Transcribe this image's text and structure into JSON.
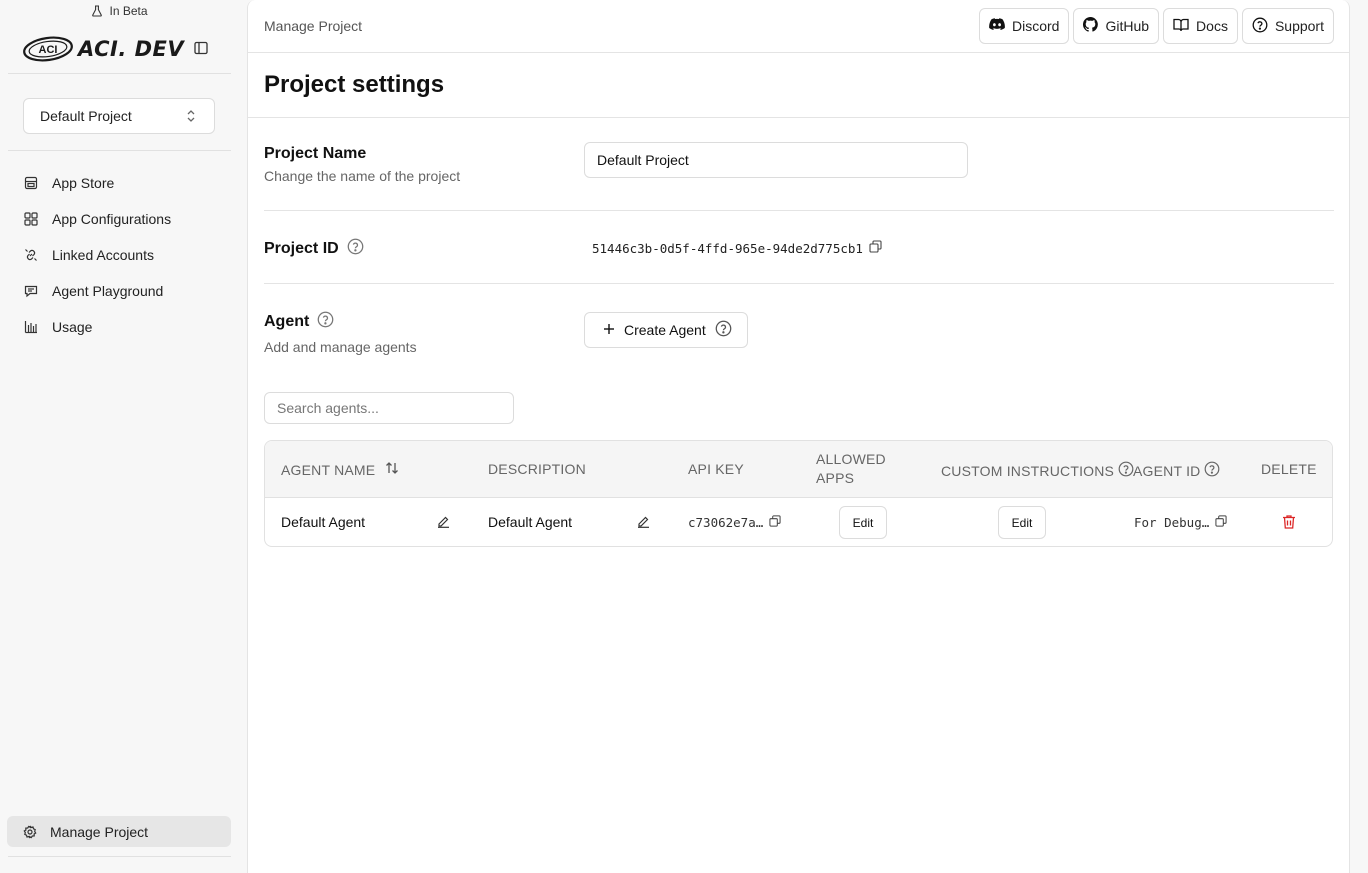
{
  "sidebar": {
    "beta_label": "In Beta",
    "logo_badge": "ACI",
    "logo_text": "ACI. DEV",
    "project_select": "Default Project",
    "nav": [
      {
        "label": "App Store",
        "icon": "store-icon"
      },
      {
        "label": "App Configurations",
        "icon": "grid-icon"
      },
      {
        "label": "Linked Accounts",
        "icon": "link-icon"
      },
      {
        "label": "Agent Playground",
        "icon": "chat-icon"
      },
      {
        "label": "Usage",
        "icon": "bar-chart-icon"
      }
    ],
    "manage_project": "Manage Project"
  },
  "header": {
    "breadcrumb": "Manage Project",
    "buttons": {
      "discord": "Discord",
      "github": "GitHub",
      "docs": "Docs",
      "support": "Support"
    }
  },
  "page": {
    "title": "Project settings",
    "project_name": {
      "label": "Project Name",
      "description": "Change the name of the project",
      "value": "Default Project"
    },
    "project_id": {
      "label": "Project ID",
      "value": "51446c3b-0d5f-4ffd-965e-94de2d775cb1"
    },
    "agent": {
      "label": "Agent",
      "description": "Add and manage agents",
      "create_button": "Create Agent"
    },
    "search": {
      "placeholder": "Search agents..."
    },
    "table": {
      "headers": {
        "agent_name": "AGENT NAME",
        "description": "DESCRIPTION",
        "api_key": "API KEY",
        "allowed_apps_1": "ALLOWED",
        "allowed_apps_2": "APPS",
        "custom_instructions": "CUSTOM INSTRUCTIONS",
        "agent_id": "AGENT ID",
        "delete": "DELETE"
      },
      "rows": [
        {
          "agent_name": "Default Agent",
          "description": "Default Agent",
          "api_key": "c73062e7a…",
          "allowed_apps_button": "Edit",
          "custom_instructions_button": "Edit",
          "agent_id": "For Debug…"
        }
      ]
    }
  },
  "colors": {
    "delete_icon": "#dc2626",
    "active_nav_bg": "#e6e6e6"
  }
}
